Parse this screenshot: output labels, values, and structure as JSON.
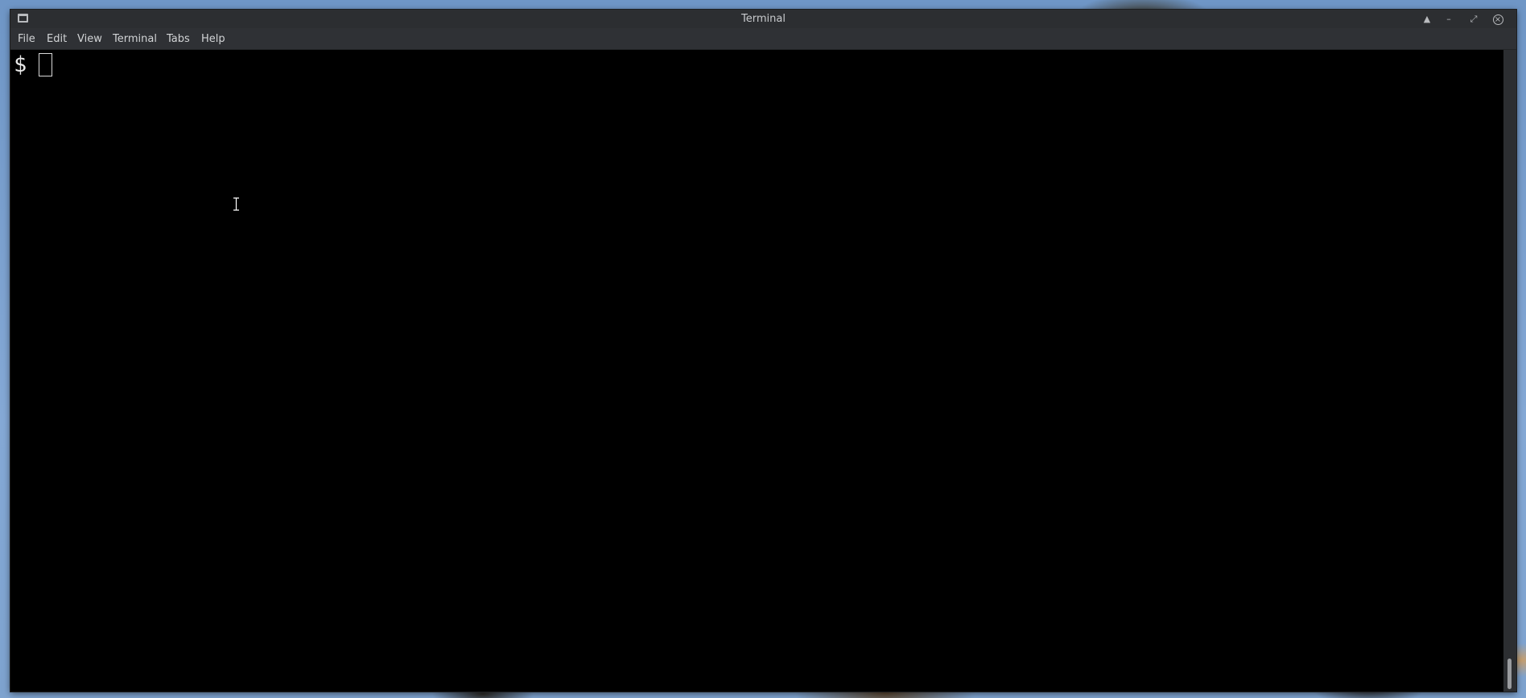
{
  "window": {
    "title": "Terminal",
    "controls": {
      "keep_above": "▲",
      "minimize": "–",
      "restore": "⤢",
      "close": "×"
    }
  },
  "menubar": {
    "items": [
      {
        "label": "File"
      },
      {
        "label": "Edit"
      },
      {
        "label": "View"
      },
      {
        "label": "Terminal"
      },
      {
        "label": "Tabs"
      },
      {
        "label": "Help"
      }
    ]
  },
  "terminal": {
    "prompt": "$"
  },
  "colors": {
    "terminal_background": "#000000",
    "terminal_foreground": "#e8e8e8",
    "window_chrome": "#2c2e31"
  }
}
